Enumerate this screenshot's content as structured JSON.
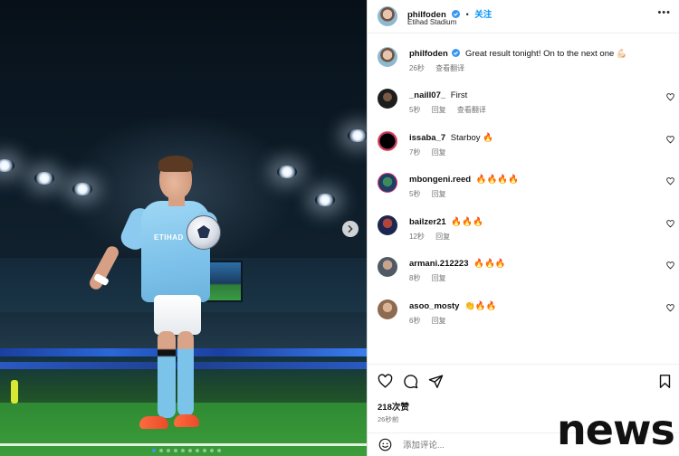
{
  "post": {
    "username": "philfoden",
    "follow_label": "关注",
    "location": "Etihad Stadium",
    "more_icon": "more-horizontal-icon",
    "photo_sponsor": "ETIHAD"
  },
  "caption": {
    "username": "philfoden",
    "text": "Great result tonight! On to the next one 💪🏻",
    "time": "26秒",
    "translate_label": "查看翻译"
  },
  "comments": [
    {
      "username": "_naill07_",
      "text": "First",
      "time": "5秒",
      "reply": "回复",
      "translate": "查看翻译"
    },
    {
      "username": "issaba_7",
      "text": "Starboy 🔥",
      "time": "7秒",
      "reply": "回复"
    },
    {
      "username": "mbongeni.reed",
      "text": "🔥🔥🔥🔥",
      "time": "5秒",
      "reply": "回复"
    },
    {
      "username": "bailzer21",
      "text": "🔥🔥🔥",
      "time": "12秒",
      "reply": "回复"
    },
    {
      "username": "armani.212223",
      "text": "🔥🔥🔥",
      "time": "8秒",
      "reply": "回复"
    },
    {
      "username": "asoo_mosty",
      "text": "👏🔥🔥",
      "time": "6秒",
      "reply": "回复"
    }
  ],
  "actions": {
    "likes": "218次赞",
    "time_ago": "26秒前",
    "icons": [
      "heart-icon",
      "comment-icon",
      "share-icon",
      "bookmark-icon"
    ]
  },
  "add_comment": {
    "placeholder": "添加评论...",
    "emoji_icon": "smiley-icon"
  },
  "watermark": "news",
  "carousel": {
    "slide_count": 10,
    "active_index": 0
  },
  "colors": {
    "accent": "#0095f6",
    "verified": "#3797f0",
    "secondary_text": "#737373"
  }
}
